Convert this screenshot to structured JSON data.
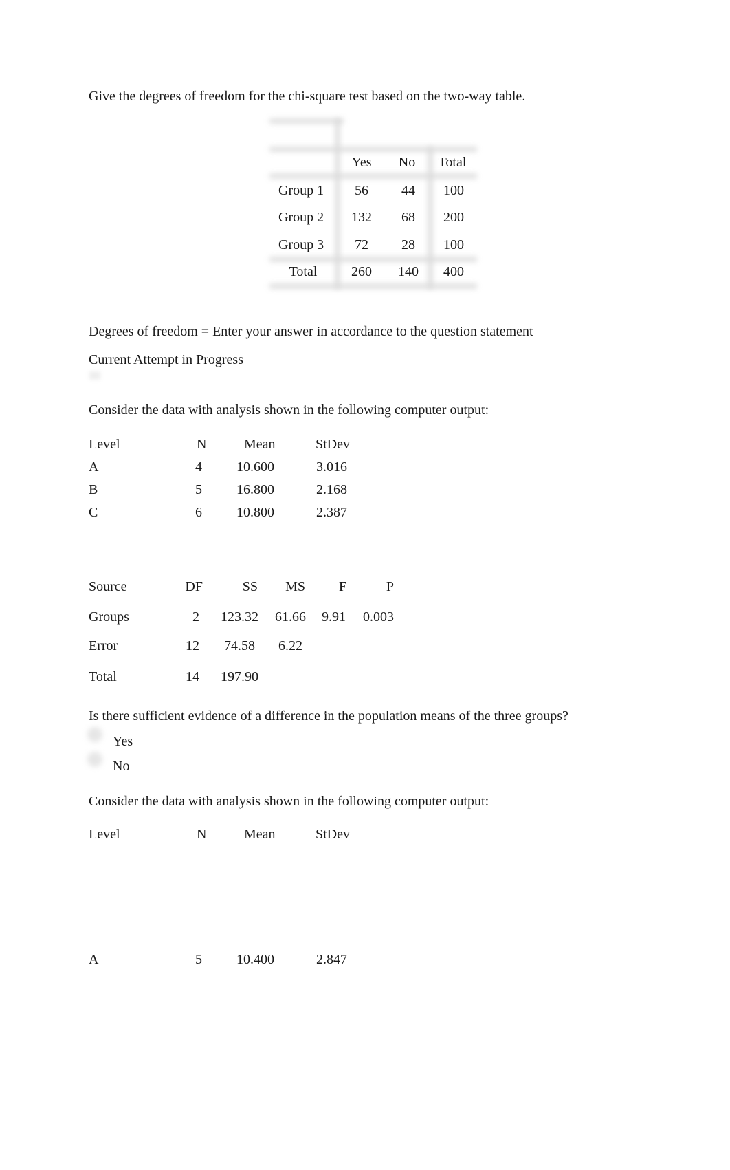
{
  "q1": {
    "prompt": "Give the degrees of freedom for the chi-square test based on the two-way table.",
    "table": {
      "headers": [
        "",
        "Yes",
        "No",
        "Total"
      ],
      "rows": [
        [
          "Group 1",
          "56",
          "44",
          "100"
        ],
        [
          "Group 2",
          "132",
          "68",
          "200"
        ],
        [
          "Group 3",
          "72",
          "28",
          "100"
        ],
        [
          "Total",
          "260",
          "140",
          "400"
        ]
      ]
    },
    "answer_label": "Degrees of freedom = Enter your answer in accordance to the question statement",
    "status": "Current Attempt in Progress"
  },
  "q2": {
    "prompt": "Consider the data with analysis shown in the following computer output:",
    "summary": {
      "headers": [
        "Level",
        "N",
        "Mean",
        "StDev"
      ],
      "rows": [
        [
          "A",
          "4",
          "10.600",
          "3.016"
        ],
        [
          "B",
          "5",
          "16.800",
          "2.168"
        ],
        [
          "C",
          "6",
          "10.800",
          "2.387"
        ]
      ]
    },
    "anova": {
      "headers": [
        "Source",
        "DF",
        "SS",
        "MS",
        "F",
        "P"
      ],
      "rows": [
        [
          "Groups",
          "2",
          "123.32",
          "61.66",
          "9.91",
          "0.003"
        ],
        [
          "Error",
          "12",
          "74.58",
          "6.22",
          "",
          ""
        ],
        [
          "Total",
          "14",
          "197.90",
          "",
          "",
          ""
        ]
      ]
    },
    "question": "Is there sufficient evidence of a difference in the population means of the three groups?",
    "options": [
      "Yes",
      "No"
    ]
  },
  "q3": {
    "prompt": "Consider the data with analysis shown in the following computer output:",
    "summary": {
      "headers": [
        "Level",
        "N",
        "Mean",
        "StDev"
      ],
      "rows": [
        [
          "A",
          "5",
          "10.400",
          "2.847"
        ]
      ]
    }
  }
}
